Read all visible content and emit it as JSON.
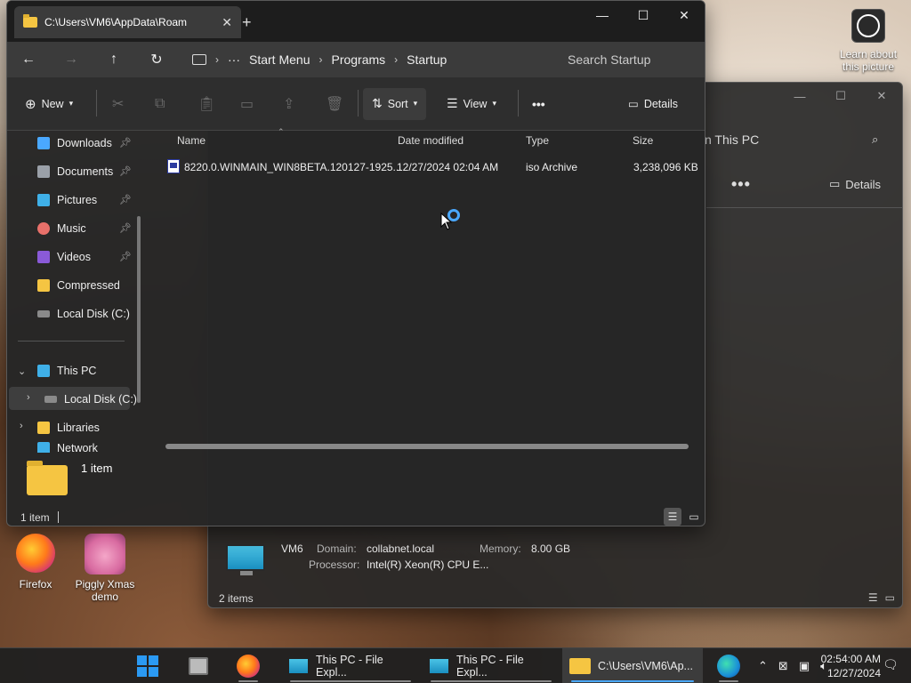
{
  "desktop": {
    "learn_icon_label": "Learn about this picture",
    "icons": [
      {
        "label": "Firefox"
      },
      {
        "label": "Piggly Xmas demo"
      }
    ]
  },
  "back_window": {
    "search_text": "n This PC",
    "more_label": "•••",
    "details_label": "Details",
    "info": {
      "name": "VM6",
      "domain_label": "Domain:",
      "domain_value": "collabnet.local",
      "memory_label": "Memory:",
      "memory_value": "8.00 GB",
      "processor_label": "Processor:",
      "processor_value": "Intel(R) Xeon(R) CPU E..."
    },
    "status": "2 items"
  },
  "front_window": {
    "tab_title": "C:\\Users\\VM6\\AppData\\Roam",
    "tab_close": "✕",
    "new_tab": "+",
    "controls": {
      "minimize": "—",
      "maximize": "☐",
      "close": "✕"
    },
    "breadcrumbs": [
      "Start Menu",
      "Programs",
      "Startup"
    ],
    "crumb_overflow": "···",
    "search_placeholder": "Search Startup",
    "toolbar": {
      "new_label": "New",
      "sort_label": "Sort",
      "view_label": "View",
      "more_label": "•••",
      "details_label": "Details"
    },
    "nav": {
      "quick": [
        {
          "label": "Downloads",
          "icon": "download-icon",
          "pinned": true
        },
        {
          "label": "Documents",
          "icon": "document-icon",
          "pinned": true
        },
        {
          "label": "Pictures",
          "icon": "pictures-icon",
          "pinned": true
        },
        {
          "label": "Music",
          "icon": "music-icon",
          "pinned": true
        },
        {
          "label": "Videos",
          "icon": "videos-icon",
          "pinned": true
        },
        {
          "label": "Compressed",
          "icon": "folder-icon",
          "pinned": false
        },
        {
          "label": "Local Disk (C:)",
          "icon": "drive-icon",
          "pinned": false
        }
      ],
      "this_pc": "This PC",
      "local_disk": "Local Disk (C:)",
      "libraries": "Libraries",
      "network_partial": "Network"
    },
    "columns": {
      "name": "Name",
      "date": "Date modified",
      "type": "Type",
      "size": "Size"
    },
    "files": [
      {
        "name": "8220.0.WINMAIN_WIN8BETA.120127-1925...",
        "date": "12/27/2024 02:04 AM",
        "type": "iso Archive",
        "size": "3,238,096 KB"
      }
    ],
    "item_count_big": "1 item",
    "status": "1 item"
  },
  "taskbar": {
    "items": [
      {
        "label": "This PC - File Expl..."
      },
      {
        "label": "This PC - File Expl..."
      },
      {
        "label": "C:\\Users\\VM6\\Ap..."
      }
    ],
    "clock_time": "02:54:00 AM",
    "clock_date": "12/27/2024"
  },
  "colors": {
    "accent": "#4aa8ff",
    "folder": "#f5c542",
    "window_bg": "#262626"
  }
}
